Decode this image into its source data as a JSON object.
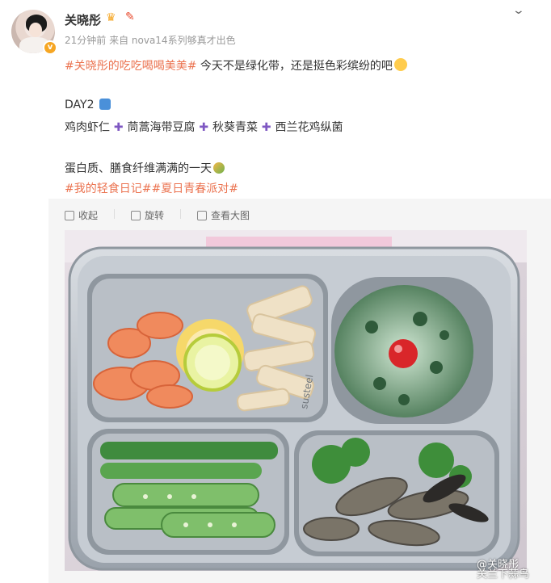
{
  "post": {
    "author": "关晓彤",
    "meta": "21分钟前  来自 nova14系列够真才出色",
    "hashtag1": "#关晓彤的吃吃喝喝美美#",
    "line1": " 今天不是绿化带，还是挺色彩缤纷的吧",
    "day": "DAY2",
    "food1": "鸡肉虾仁",
    "food2": "茼蒿海带豆腐",
    "food3": "秋葵青菜",
    "food4": "西兰花鸡纵菌",
    "line3": "蛋白质、膳食纤维满满的一天",
    "hashtags2": "#我的轻食日记##夏日青春派对#"
  },
  "actions": {
    "collapse": "收起",
    "rotate": "旋转",
    "view_large": "查看大图"
  },
  "watermark": {
    "line1": "@关晓彤",
    "line2": "关兰下蒜鸟"
  },
  "colors": {
    "tag": "#eb7350",
    "plus": "#7e57c2",
    "badge": "#f6a623"
  }
}
